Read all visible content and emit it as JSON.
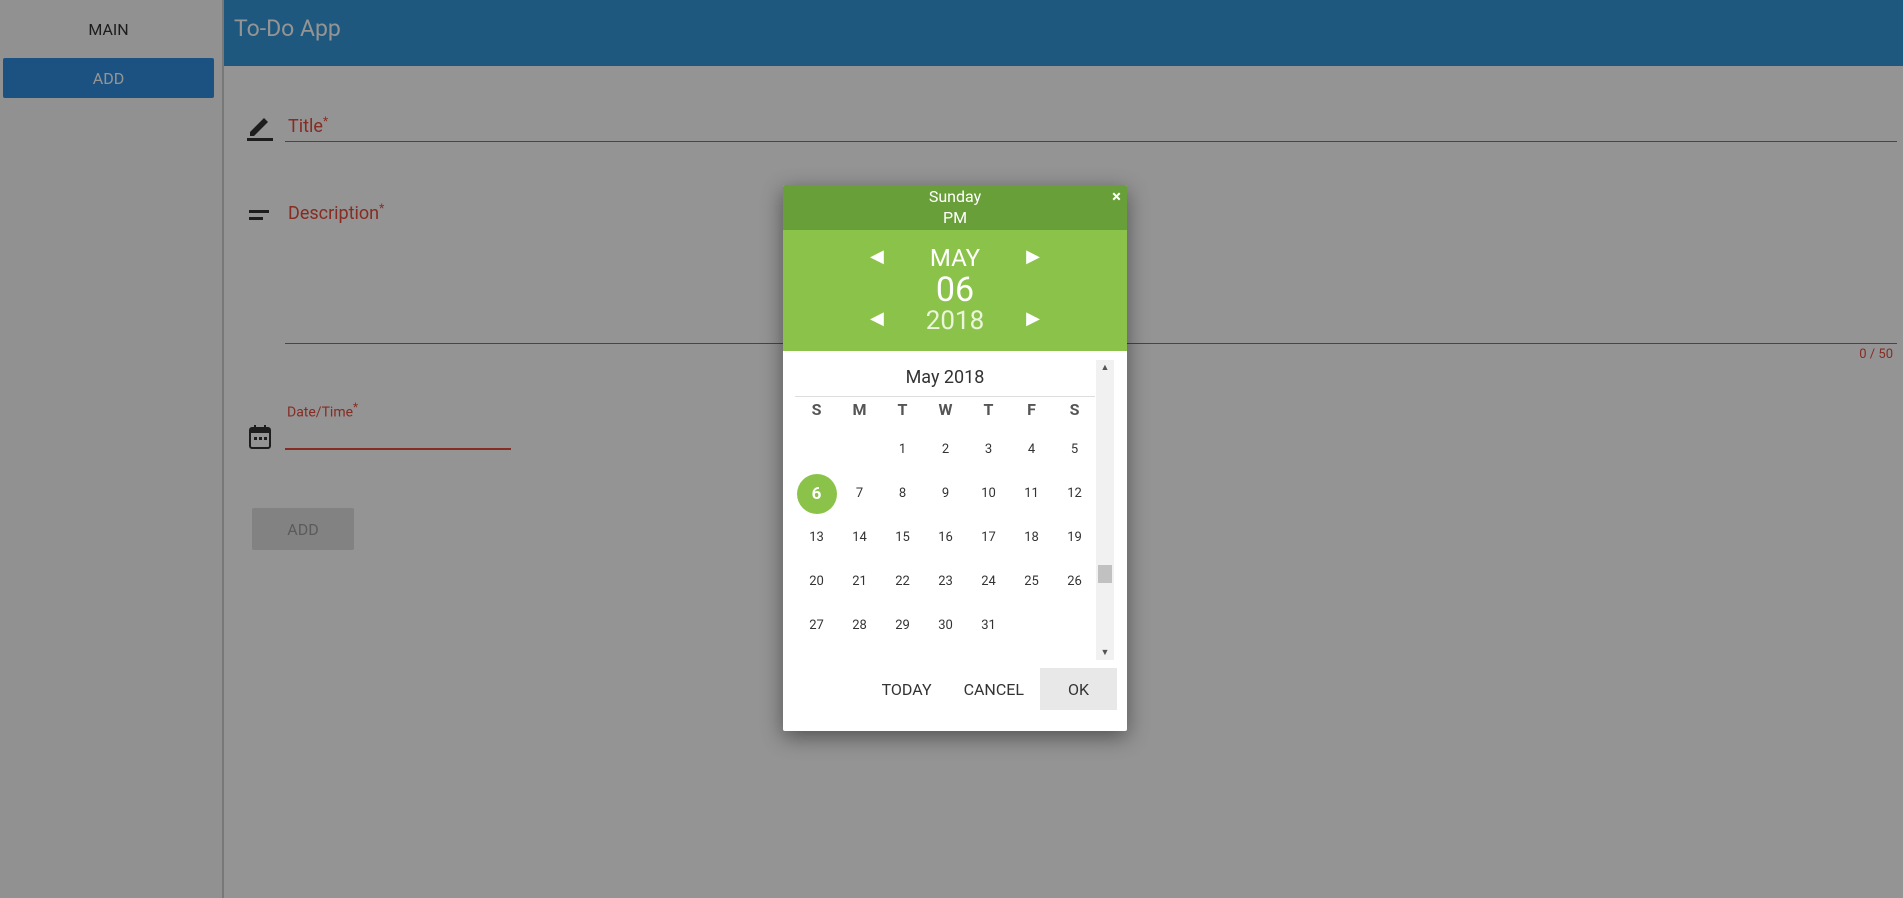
{
  "sidebar": {
    "items": [
      {
        "label": "MAIN"
      },
      {
        "label": "ADD"
      }
    ]
  },
  "header": {
    "title": "To-Do App"
  },
  "form": {
    "title_label": "Title",
    "description_label": "Description",
    "counter": "0 / 50",
    "datetime_label": "Date/Time",
    "required_mark": "*",
    "add_button": "ADD"
  },
  "picker": {
    "weekday": "Sunday",
    "ampm": "PM",
    "month": "MAY",
    "day": "06",
    "year": "2018",
    "close": "×",
    "calendar_title": "May 2018",
    "weekday_headers": [
      "S",
      "M",
      "T",
      "W",
      "T",
      "F",
      "S"
    ],
    "weeks": [
      [
        "",
        "",
        "1",
        "2",
        "3",
        "4",
        "5"
      ],
      [
        "6",
        "7",
        "8",
        "9",
        "10",
        "11",
        "12"
      ],
      [
        "13",
        "14",
        "15",
        "16",
        "17",
        "18",
        "19"
      ],
      [
        "20",
        "21",
        "22",
        "23",
        "24",
        "25",
        "26"
      ],
      [
        "27",
        "28",
        "29",
        "30",
        "31",
        "",
        ""
      ]
    ],
    "selected_day": "6",
    "today_label": "TODAY",
    "cancel_label": "CANCEL",
    "ok_label": "OK"
  },
  "colors": {
    "header": "#3498db",
    "accent_red": "#e74c3c",
    "picker_dark_green": "#689f38",
    "picker_green": "#8bc34a",
    "sidebar_active": "#2f8ee0"
  }
}
